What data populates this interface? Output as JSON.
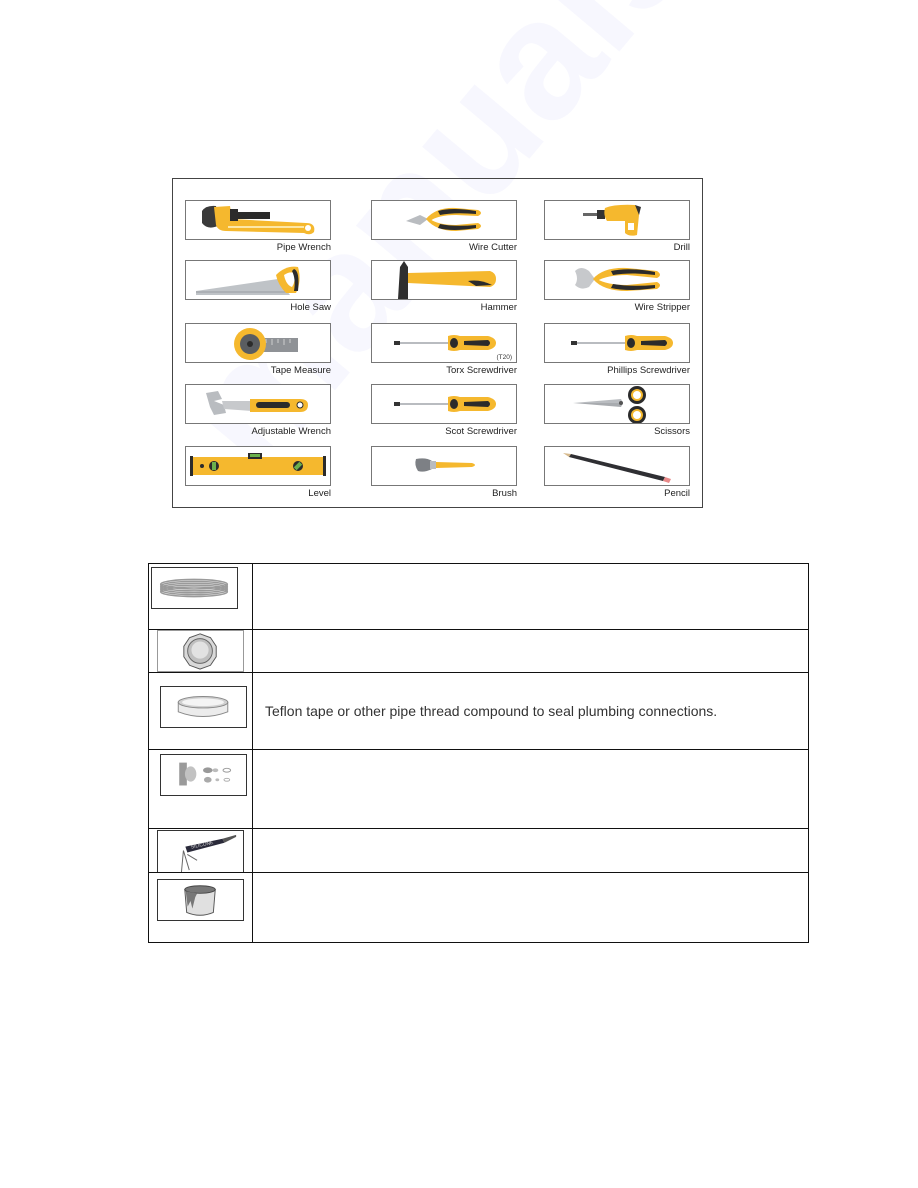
{
  "tools_panel": {
    "tools": [
      {
        "label": "Pipe Wrench",
        "icon": "pipe-wrench-icon"
      },
      {
        "label": "Wire Cutter",
        "icon": "wire-cutter-icon"
      },
      {
        "label": "Drill",
        "icon": "drill-icon"
      },
      {
        "label": "Hole Saw",
        "icon": "hand-saw-icon"
      },
      {
        "label": "Hammer",
        "icon": "hammer-icon"
      },
      {
        "label": "Wire Stripper",
        "icon": "wire-stripper-icon"
      },
      {
        "label": "Tape Measure",
        "icon": "tape-measure-icon"
      },
      {
        "label": "Torx Screwdriver",
        "icon": "torx-screwdriver-icon",
        "sublabel": "(T20)"
      },
      {
        "label": "Phillips Screwdriver",
        "icon": "phillips-screwdriver-icon"
      },
      {
        "label": "Adjustable Wrench",
        "icon": "adjustable-wrench-icon"
      },
      {
        "label": "Scot Screwdriver",
        "icon": "slotted-screwdriver-icon"
      },
      {
        "label": "Scissors",
        "icon": "scissors-icon"
      },
      {
        "label": "Level",
        "icon": "level-icon"
      },
      {
        "label": "Brush",
        "icon": "brush-icon"
      },
      {
        "label": "Pencil",
        "icon": "pencil-icon"
      }
    ]
  },
  "supplies_table": {
    "rows": [
      {
        "icon": "coiled-tubing-icon",
        "text": ""
      },
      {
        "icon": "compression-nut-icon",
        "text": ""
      },
      {
        "icon": "teflon-tape-icon",
        "text": "Teflon tape or other pipe thread compound to seal plumbing connections."
      },
      {
        "icon": "fittings-hardware-icon",
        "text": ""
      },
      {
        "icon": "caulk-gun-icon",
        "text": "",
        "tube_label": "SILICONE"
      },
      {
        "icon": "paint-can-icon",
        "text": ""
      }
    ]
  },
  "watermark": {
    "text": "manualslib.com"
  },
  "colors": {
    "tool_yellow": "#f5b82e",
    "tool_black": "#2b2b2b",
    "steel": "#b9bcc0"
  }
}
